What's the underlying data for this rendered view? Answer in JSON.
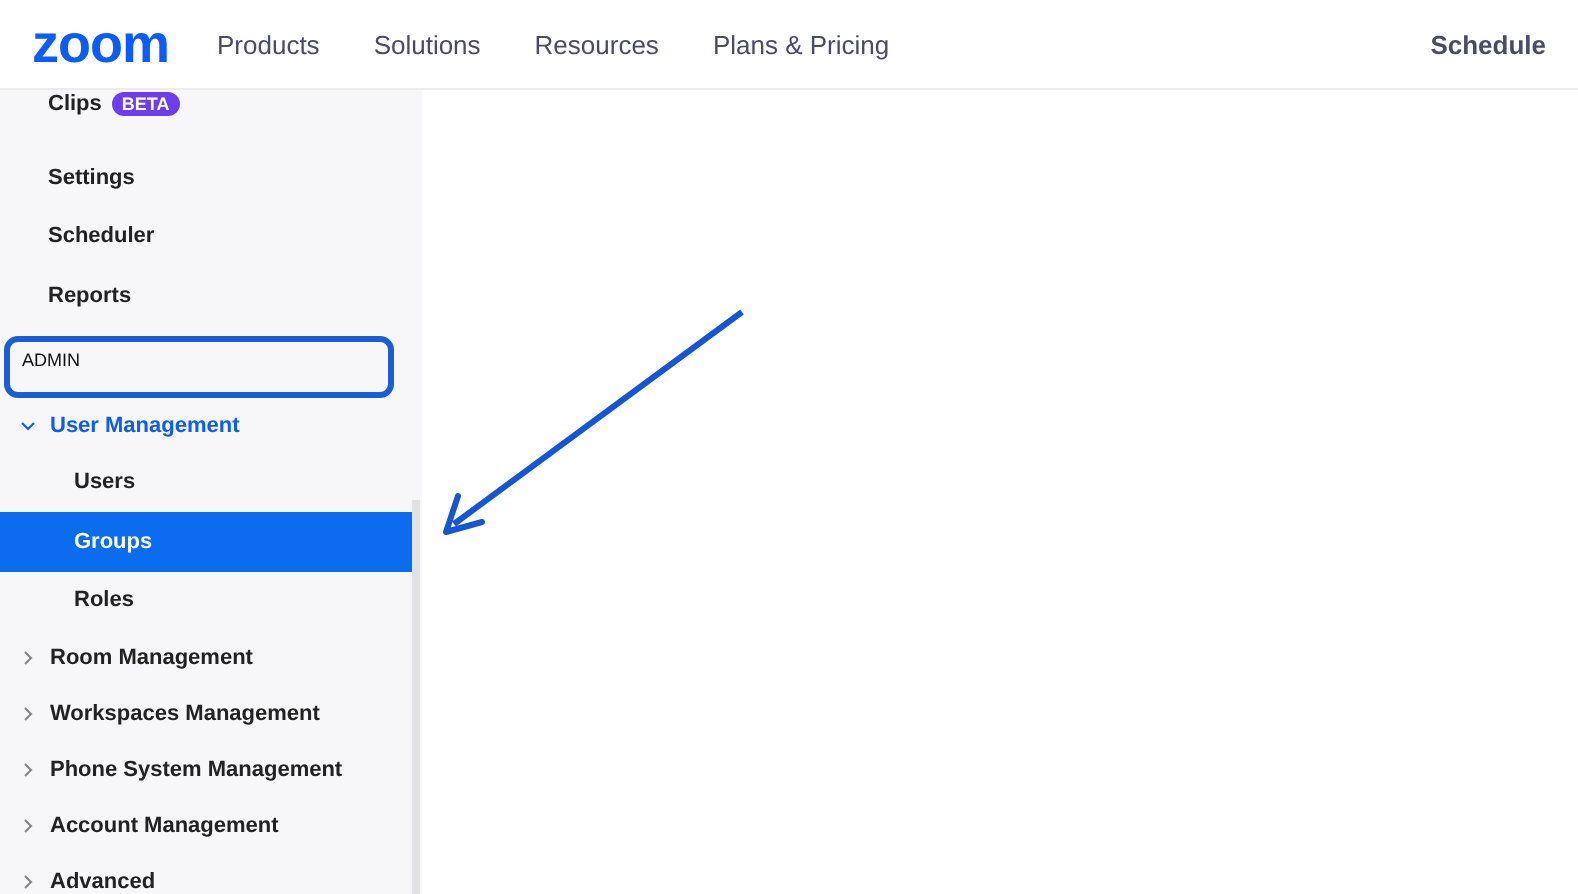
{
  "header": {
    "logo": "zoom",
    "nav": [
      {
        "label": "Products"
      },
      {
        "label": "Solutions"
      },
      {
        "label": "Resources"
      },
      {
        "label": "Plans & Pricing"
      }
    ],
    "action": "Schedule"
  },
  "sidebar": {
    "items": [
      {
        "label": "Clips",
        "badge": "BETA",
        "selected": false
      },
      {
        "label": "Settings",
        "selected": false
      },
      {
        "label": "Scheduler",
        "selected": false
      },
      {
        "label": "Reports",
        "selected": false
      }
    ],
    "section": {
      "label": "ADMIN",
      "highlighted": true
    },
    "admin_items": [
      {
        "label": "User Management",
        "expanded": true,
        "selected": false,
        "children": [
          {
            "label": "Users",
            "selected": false
          },
          {
            "label": "Groups",
            "selected": true
          },
          {
            "label": "Roles",
            "selected": false
          }
        ]
      },
      {
        "label": "Room Management",
        "expanded": false,
        "selected": false
      },
      {
        "label": "Workspaces Management",
        "expanded": false,
        "selected": false
      },
      {
        "label": "Phone System Management",
        "expanded": false,
        "selected": false
      },
      {
        "label": "Account Management",
        "expanded": false,
        "selected": false
      },
      {
        "label": "Advanced",
        "expanded": false,
        "selected": false
      }
    ]
  },
  "annotation": {
    "arrow": true
  }
}
